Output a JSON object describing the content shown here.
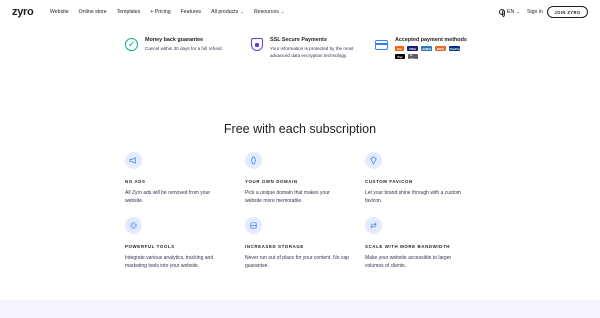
{
  "nav": {
    "logo": "zyro",
    "links": [
      {
        "label": "Website",
        "chevron": false
      },
      {
        "label": "Online store",
        "chevron": false
      },
      {
        "label": "Templates",
        "chevron": false
      },
      {
        "label": "+ Pricing",
        "chevron": false
      },
      {
        "label": "Features",
        "chevron": false
      },
      {
        "label": "All products",
        "chevron": true
      },
      {
        "label": "Resources",
        "chevron": true
      }
    ],
    "language": "EN",
    "signin": "Sign in",
    "join": "JOIN ZYRO"
  },
  "guarantees": {
    "money": {
      "title": "Money back guarantee",
      "text": "Cancel within 30 days for a full refund."
    },
    "ssl": {
      "title": "SSL Secure Payments",
      "text": "Your information is protected by the most advanced data encryption technology."
    },
    "payment": {
      "title": "Accepted payment methods"
    }
  },
  "payment_methods": [
    {
      "name": "mastercard",
      "label": "MC",
      "color": "#ff5f00"
    },
    {
      "name": "visa",
      "label": "VISA",
      "color": "#1a1f71"
    },
    {
      "name": "amex",
      "label": "AMEX",
      "color": "#2e77bc"
    },
    {
      "name": "discover",
      "label": "DISC",
      "color": "#e4702e"
    },
    {
      "name": "paypal",
      "label": "PayPal",
      "color": "#003087"
    },
    {
      "name": "applepay",
      "label": "Pay",
      "color": "#000000"
    },
    {
      "name": "googlepay",
      "label": "G Pay",
      "color": "#5f6368"
    }
  ],
  "heading": "Free with each subscription",
  "features": [
    {
      "icon": "megaphone-icon",
      "glyph": "📢",
      "title": "NO ADS",
      "text": "All Zyro ads will be removed from your website."
    },
    {
      "icon": "domain-icon",
      "glyph": "◎",
      "title": "YOUR OWN DOMAIN",
      "text": "Pick a unique domain that makes your website more memorable."
    },
    {
      "icon": "favicon-icon",
      "glyph": "◇",
      "title": "CUSTOM FAVICON",
      "text": "Let your brand shine through with a custom favicon."
    },
    {
      "icon": "tools-icon",
      "glyph": "⚙",
      "title": "POWERFUL TOOLS",
      "text": "Integrate various analytics, tracking and marketing tools into your website."
    },
    {
      "icon": "storage-icon",
      "glyph": "▤",
      "title": "INCREASED STORAGE",
      "text": "Never run out of place for your content. No cap guarantee."
    },
    {
      "icon": "bandwidth-icon",
      "glyph": "⇄",
      "title": "SCALE WITH MORE BANDWIDTH",
      "text": "Make your website accessible to larger volumes of clients."
    }
  ]
}
